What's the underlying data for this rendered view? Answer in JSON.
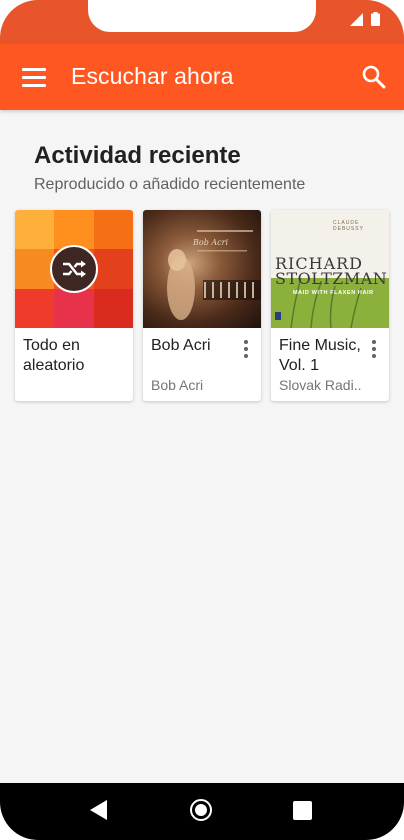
{
  "app": {
    "title": "Escuchar ahora"
  },
  "section": {
    "title": "Actividad reciente",
    "subtitle": "Reproducido o añadido recientemente"
  },
  "cards": [
    {
      "title": "Todo en aleatorio",
      "subtitle": ""
    },
    {
      "title": "Bob Acri",
      "subtitle": "Bob Acri"
    },
    {
      "title": "Fine Music, Vol. 1",
      "subtitle": "Slovak Radi.."
    }
  ],
  "album_art": {
    "debussy": {
      "composer": "CLAUDE DEBUSSY",
      "artist_line1": "RICHARD",
      "artist_line2": "STOLTZMAN",
      "album": "MAID WITH FLAXEN HAIR"
    },
    "bob_acri": {
      "script": "Bob Acri"
    }
  },
  "icons": {
    "menu": "menu-icon",
    "search": "search-icon",
    "shuffle": "shuffle-icon",
    "more": "more-vertical-icon"
  },
  "colors": {
    "app_bar": "#ff5722",
    "status_bar": "#e8552a",
    "shuffle_badge": "#3e2723",
    "debussy_green": "#8bb13c"
  }
}
